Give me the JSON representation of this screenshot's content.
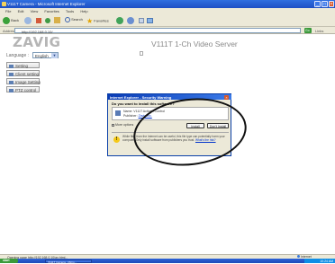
{
  "window": {
    "title": "V111T Camera - Microsoft Internet Explorer",
    "menu": [
      "File",
      "Edit",
      "View",
      "Favorites",
      "Tools",
      "Help"
    ],
    "toolbar": {
      "back": "Back",
      "search": "Search",
      "favorites": "Favorites"
    },
    "address_label": "Address",
    "address_value": "http://192.168.0.10/",
    "go_label": "Go",
    "links_label": "Links"
  },
  "page": {
    "logo": "ZAVIG",
    "heading": "V111T 1-Ch Video Server",
    "language_label": "Language :",
    "language_value": "English",
    "nav": [
      "Setting",
      "Client setting",
      "Image Setting",
      "PTZ control"
    ]
  },
  "dialog": {
    "title": "Internet Explorer - Security Warning",
    "question": "Do you want to install this software?",
    "name_label": "Name:",
    "name_value": "V111T ActiveX Control",
    "publisher_label": "Publisher:",
    "publisher_value": "Zavio Inc.",
    "more_options": "More options",
    "install": "Install",
    "dont_install": "Don't Install",
    "warning": "While files from the Internet can be useful, this file type can potentially harm your computer. Only install software from publishers you trust.",
    "warning_link": "What's the risk?"
  },
  "status": {
    "text": "Opening page http://192.168.0.10/ax.html...",
    "zone": "Internet"
  },
  "taskbar": {
    "start": "start",
    "item": "V111T Camera - Micro...",
    "clock": "10:24 AM"
  },
  "colors": {
    "titlebar": "#1d4fc4",
    "window_chrome": "#ece9d8",
    "dialog_title": "#0a3cb5",
    "annotation_oval": "#111111"
  }
}
